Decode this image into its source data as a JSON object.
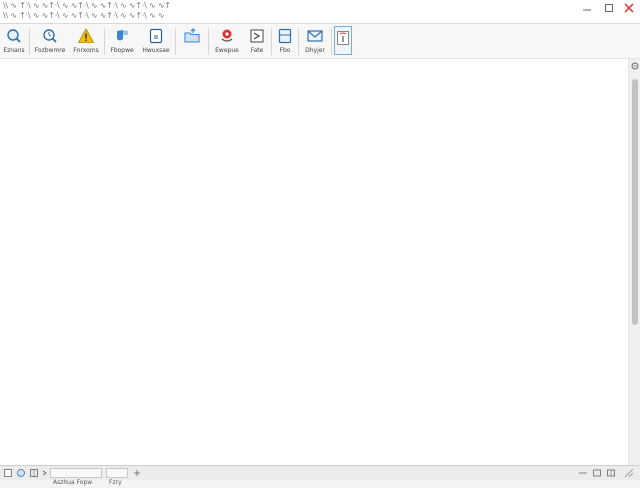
{
  "window": {
    "title_line1": "\\\\ ∿ ↑·\\ ∿ ∿↑·\\ ∿ ∿↑·\\ ∿ ∿↑·\\ ∿ ∿↑·\\ ∿ ∿↑",
    "title_line2": "\\\\ ∿ ↑·\\ ∿ ∿↑·\\ ∿ ∿↑·\\ ∿ ∿↑·\\ ∿ ∿↑·\\ ∿ ∿"
  },
  "toolbar": {
    "buttons": [
      {
        "label": "Eznans",
        "icon": "search-icon"
      },
      {
        "label": "Fozbwmre",
        "icon": "clock-search-icon"
      },
      {
        "label": "Fnrxoms",
        "icon": "warning-icon"
      },
      {
        "label": "Fbopwe",
        "icon": "shield-icon"
      },
      {
        "label": "Hwuxsae",
        "icon": "document-icon"
      },
      {
        "label": "",
        "icon": "folder-upload-icon"
      },
      {
        "label": "Ewepue",
        "icon": "pin-icon"
      },
      {
        "label": "Fate",
        "icon": "flag-icon"
      },
      {
        "label": "Fbo",
        "icon": "panel-icon"
      },
      {
        "label": "Dhyjer",
        "icon": "mail-icon"
      },
      {
        "label": "",
        "icon": "info-page-icon"
      }
    ]
  },
  "statusbar": {
    "field1": "Aszhua Fopw",
    "field2": "Fzry"
  },
  "colors": {
    "accent": "#3a86d0",
    "warning": "#f2c200",
    "close": "#e04040"
  }
}
